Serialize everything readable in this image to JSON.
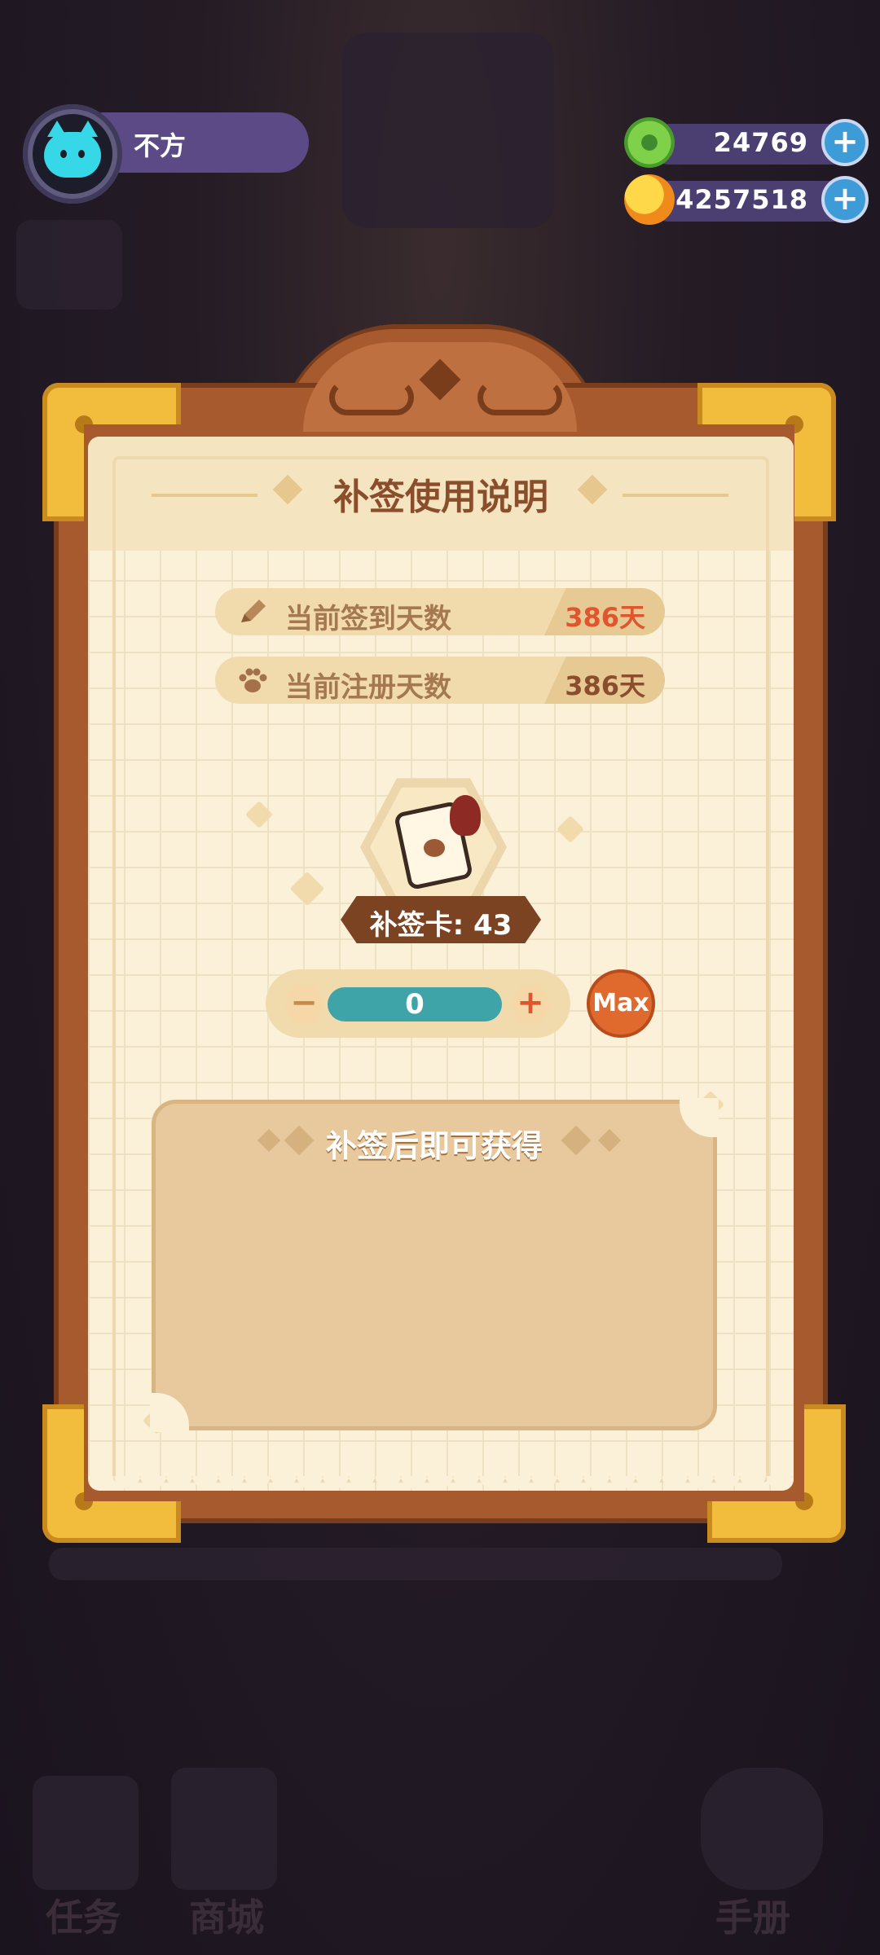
{
  "profile": {
    "name": "不方"
  },
  "currency": {
    "donut": {
      "value": "24769"
    },
    "coin": {
      "value": "4257518"
    }
  },
  "dialog": {
    "title": "补签使用说明",
    "stats": [
      {
        "label": "当前签到天数",
        "value": "386天",
        "color": "#e0552e",
        "icon": "pencil-icon"
      },
      {
        "label": "当前注册天数",
        "value": "386天",
        "color": "#8a4e2c",
        "icon": "paw-icon"
      }
    ],
    "card": {
      "label": "补签卡: 43"
    },
    "quantity": {
      "value": "0",
      "minus": "−",
      "plus": "+",
      "max_label": "Max"
    },
    "reward": {
      "title": "补签后即可获得"
    }
  },
  "background": {
    "bottom_left": "任务",
    "bottom_mid": "商城",
    "bottom_right": "手册"
  }
}
